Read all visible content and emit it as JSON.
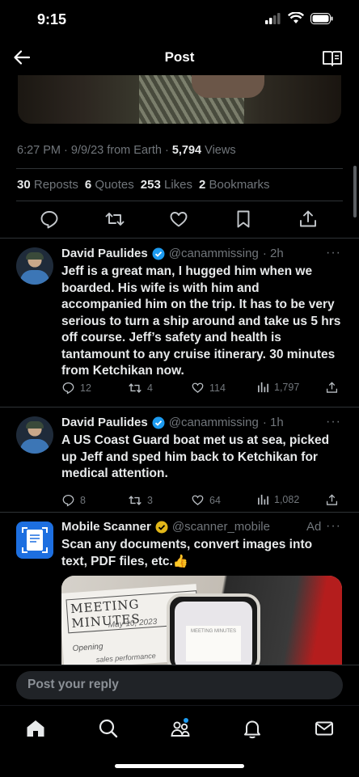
{
  "status": {
    "time": "9:15"
  },
  "nav": {
    "title": "Post"
  },
  "post": {
    "time": "6:27 PM",
    "date": "9/9/23",
    "source": "from Earth",
    "views_count": "5,794",
    "views_label": "Views",
    "reposts_count": "30",
    "reposts_label": "Reposts",
    "quotes_count": "6",
    "quotes_label": "Quotes",
    "likes_count": "253",
    "likes_label": "Likes",
    "bookmarks_count": "2",
    "bookmarks_label": "Bookmarks"
  },
  "replies": [
    {
      "name": "David Paulides",
      "handle": "@canammissing",
      "age": "· 2h",
      "text": "Jeff is a great man, I hugged him when we boarded. His wife is with him and accompanied him on the trip. It has to be very serious to turn a ship around and take us 5 hrs off course. Jeff’s safety and health is tantamount to any cruise itinerary. 30 minutes from Ketchikan now.",
      "replies": "12",
      "reposts": "4",
      "likes": "114",
      "views": "1,797"
    },
    {
      "name": "David Paulides",
      "handle": "@canammissing",
      "age": "· 1h",
      "text": "A US Coast Guard boat met us at sea, picked up Jeff and sped him back to Ketchikan for medical attention.",
      "replies": "8",
      "reposts": "3",
      "likes": "64",
      "views": "1,082"
    }
  ],
  "ad": {
    "name": "Mobile Scanner",
    "handle": "@scanner_mobile",
    "label": "Ad",
    "text": "Scan any documents, convert images into text, PDF files, etc.",
    "emoji": "👍",
    "image_note_title": "MEETING MINUTES",
    "image_note_date": "May 10, 2023",
    "image_note_line1": "Opening",
    "image_note_line2": "sales performance"
  },
  "reply_box": {
    "placeholder": "Post your reply"
  },
  "colors": {
    "accent": "#1d9bf0",
    "gold_badge": "#e2b719",
    "muted": "#71767b"
  },
  "icons": [
    "back-arrow-icon",
    "reader-icon",
    "comment-icon",
    "repost-icon",
    "heart-icon",
    "bookmark-icon",
    "share-icon",
    "analytics-icon",
    "home-icon",
    "search-icon",
    "communities-icon",
    "bell-icon",
    "mail-icon",
    "verified-badge-icon"
  ]
}
